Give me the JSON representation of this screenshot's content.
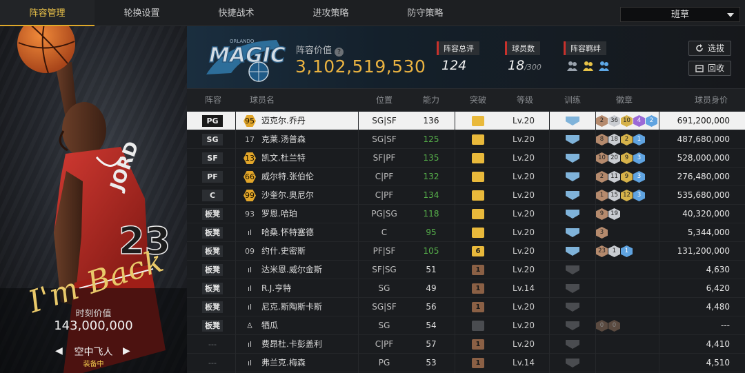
{
  "nav": {
    "tabs": [
      "阵容管理",
      "轮换设置",
      "快捷战术",
      "进攻策略",
      "防守策略"
    ],
    "active": 0,
    "team_select": "班草"
  },
  "card": {
    "signature": "I'm Back",
    "mv_label": "时刻价值",
    "mv_value": "143,000,000",
    "name": "空中飞人",
    "status": "装备中",
    "jersey_text": "JORD",
    "jersey_num": "23"
  },
  "header": {
    "team_logo_text": "MAGIC",
    "team_logo_small": "ORLANDO",
    "value_label": "阵容价值",
    "team_value": "3,102,519,530",
    "overall_label": "阵容总评",
    "overall": "124",
    "count_label": "球员数",
    "count": "18",
    "count_max": "/300",
    "bond_label": "阵容羁绊",
    "btn_scout": "选拔",
    "btn_recycle": "回收"
  },
  "columns": [
    "阵容",
    "球员名",
    "位置",
    "能力",
    "突破",
    "等级",
    "训练",
    "徽章",
    "球员身价"
  ],
  "colors": {
    "accent": "#e0a92a",
    "ability_green": "#57b24b",
    "train_blue": "#7fb3da"
  },
  "rows": [
    {
      "slot": "PG",
      "ovr": "95",
      "ovr_type": "gold",
      "name": "迈克尔.乔丹",
      "pos": "SG|SF",
      "ability": "136",
      "green": false,
      "crown": "gold",
      "crown_text": "",
      "lv": "Lv.20",
      "train": true,
      "badges": [
        [
          "b",
          "2"
        ],
        [
          "s",
          "36"
        ],
        [
          "g",
          "10"
        ],
        [
          "p",
          "4"
        ],
        [
          "u",
          "2"
        ]
      ],
      "salary": "691,200,000",
      "sel": true
    },
    {
      "slot": "SG",
      "ovr": "17",
      "ovr_type": "plain",
      "name": "克莱.汤普森",
      "pos": "SG|SF",
      "ability": "125",
      "green": true,
      "crown": "gold",
      "crown_text": "",
      "lv": "Lv.20",
      "train": true,
      "badges": [
        [
          "b",
          "8"
        ],
        [
          "s",
          "18"
        ],
        [
          "g",
          "2"
        ],
        [
          "u",
          "1"
        ]
      ],
      "salary": "487,680,000",
      "sel": false
    },
    {
      "slot": "SF",
      "ovr": "13",
      "ovr_type": "gold",
      "name": "凯文.杜兰特",
      "pos": "SF|PF",
      "ability": "135",
      "green": true,
      "crown": "gold",
      "crown_text": "",
      "lv": "Lv.20",
      "train": true,
      "badges": [
        [
          "b",
          "10"
        ],
        [
          "s",
          "20"
        ],
        [
          "g",
          "9"
        ],
        [
          "u",
          "3"
        ]
      ],
      "salary": "528,000,000",
      "sel": false
    },
    {
      "slot": "PF",
      "ovr": "66",
      "ovr_type": "gold",
      "name": "威尔特.张伯伦",
      "pos": "C|PF",
      "ability": "132",
      "green": true,
      "crown": "gold",
      "crown_text": "",
      "lv": "Lv.20",
      "train": true,
      "badges": [
        [
          "b",
          "2"
        ],
        [
          "s",
          "11"
        ],
        [
          "g",
          "9"
        ],
        [
          "u",
          "3"
        ]
      ],
      "salary": "276,480,000",
      "sel": false
    },
    {
      "slot": "C",
      "ovr": "99",
      "ovr_type": "gold",
      "name": "沙奎尔.奥尼尔",
      "pos": "C|PF",
      "ability": "134",
      "green": true,
      "crown": "gold",
      "crown_text": "",
      "lv": "Lv.20",
      "train": true,
      "badges": [
        [
          "b",
          "1"
        ],
        [
          "s",
          "15"
        ],
        [
          "g",
          "12"
        ],
        [
          "u",
          "3"
        ]
      ],
      "salary": "535,680,000",
      "sel": false
    },
    {
      "slot": "板凳",
      "ovr": "93",
      "ovr_type": "plain",
      "name": "罗恩.哈珀",
      "pos": "PG|SG",
      "ability": "118",
      "green": true,
      "crown": "gold",
      "crown_text": "",
      "lv": "Lv.20",
      "train": true,
      "badges": [
        [
          "b",
          "9"
        ],
        [
          "s",
          "19"
        ]
      ],
      "salary": "40,320,000",
      "sel": false
    },
    {
      "slot": "板凳",
      "ovr": "ıl",
      "ovr_type": "ic",
      "name": "哈桑.怀特塞德",
      "pos": "C",
      "ability": "95",
      "green": true,
      "crown": "gold",
      "crown_text": "",
      "lv": "Lv.20",
      "train": true,
      "badges": [
        [
          "b",
          "3"
        ]
      ],
      "salary": "5,344,000",
      "sel": false
    },
    {
      "slot": "板凳",
      "ovr": "09",
      "ovr_type": "plain",
      "name": "约什.史密斯",
      "pos": "PF|SF",
      "ability": "105",
      "green": true,
      "crown": "gold",
      "crown_text": "6",
      "lv": "Lv.20",
      "train": true,
      "badges": [
        [
          "b",
          "23"
        ],
        [
          "s",
          "1"
        ],
        [
          "u",
          "1"
        ]
      ],
      "salary": "131,200,000",
      "sel": false
    },
    {
      "slot": "板凳",
      "ovr": "ıl",
      "ovr_type": "ic",
      "name": "达米恩.威尔金斯",
      "pos": "SF|SG",
      "ability": "51",
      "green": false,
      "crown": "brown",
      "crown_text": "1",
      "lv": "Lv.20",
      "train": false,
      "badges": [],
      "salary": "4,630",
      "sel": false
    },
    {
      "slot": "板凳",
      "ovr": "ıl",
      "ovr_type": "ic",
      "name": "R.J.亨特",
      "pos": "SG",
      "ability": "49",
      "green": false,
      "crown": "brown",
      "crown_text": "1",
      "lv": "Lv.14",
      "train": false,
      "badges": [],
      "salary": "6,420",
      "sel": false
    },
    {
      "slot": "板凳",
      "ovr": "ıl",
      "ovr_type": "ic",
      "name": "尼克.斯陶斯卡斯",
      "pos": "SG|SF",
      "ability": "56",
      "green": false,
      "crown": "brown",
      "crown_text": "1",
      "lv": "Lv.20",
      "train": false,
      "badges": [],
      "salary": "4,480",
      "sel": false
    },
    {
      "slot": "板凳",
      "ovr": "♙",
      "ovr_type": "ic",
      "name": "牺瓜",
      "pos": "SG",
      "ability": "54",
      "green": false,
      "crown": "grey",
      "crown_text": "",
      "lv": "Lv.20",
      "train": false,
      "badges": [
        [
          "d",
          "0"
        ],
        [
          "d",
          "0"
        ]
      ],
      "salary": "---",
      "sel": false
    },
    {
      "slot": "---",
      "ovr": "ıl",
      "ovr_type": "ic",
      "name": "费昂杜.卡彭盖利",
      "pos": "C|PF",
      "ability": "57",
      "green": false,
      "crown": "brown",
      "crown_text": "1",
      "lv": "Lv.20",
      "train": false,
      "badges": [],
      "salary": "4,410",
      "sel": false
    },
    {
      "slot": "---",
      "ovr": "ıl",
      "ovr_type": "ic",
      "name": "弗兰克.梅森",
      "pos": "PG",
      "ability": "53",
      "green": false,
      "crown": "brown",
      "crown_text": "1",
      "lv": "Lv.14",
      "train": false,
      "badges": [],
      "salary": "4,510",
      "sel": false
    }
  ]
}
